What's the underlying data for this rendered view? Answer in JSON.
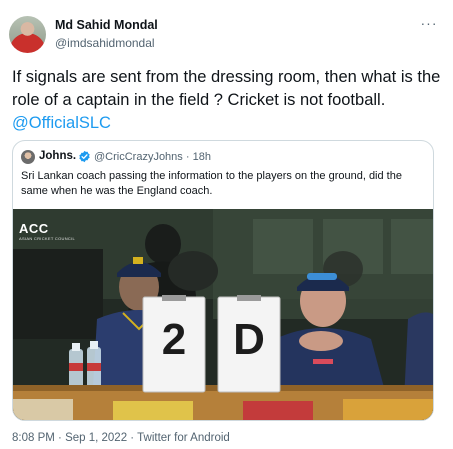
{
  "author": {
    "name": "Md Sahid Mondal",
    "handle": "@imdsahidmondal"
  },
  "more_label": "···",
  "tweet": {
    "text": "If signals are sent from the dressing room, then what is the role of a captain in the field ? Cricket is not football.",
    "mention": "@OfficialSLC"
  },
  "quoted": {
    "name": "Johns.",
    "handle": "@CricCrazyJohns",
    "time": "18h",
    "text": "Sri Lankan coach passing the information to the players on the ground, did the same when he was the England coach.",
    "media": {
      "logo": "ACC",
      "logo_sub": "ASIAN CRICKET COUNCIL",
      "board_left": "2",
      "board_right": "D"
    }
  },
  "meta": {
    "time": "8:08 PM",
    "date": "Sep 1, 2022",
    "source": "Twitter for Android"
  },
  "colors": {
    "link": "#1d9bf0",
    "secondary_text": "#536471",
    "border": "#cfd9de"
  },
  "icons": {
    "verified": "verified-badge-icon",
    "more": "more-options-icon"
  }
}
